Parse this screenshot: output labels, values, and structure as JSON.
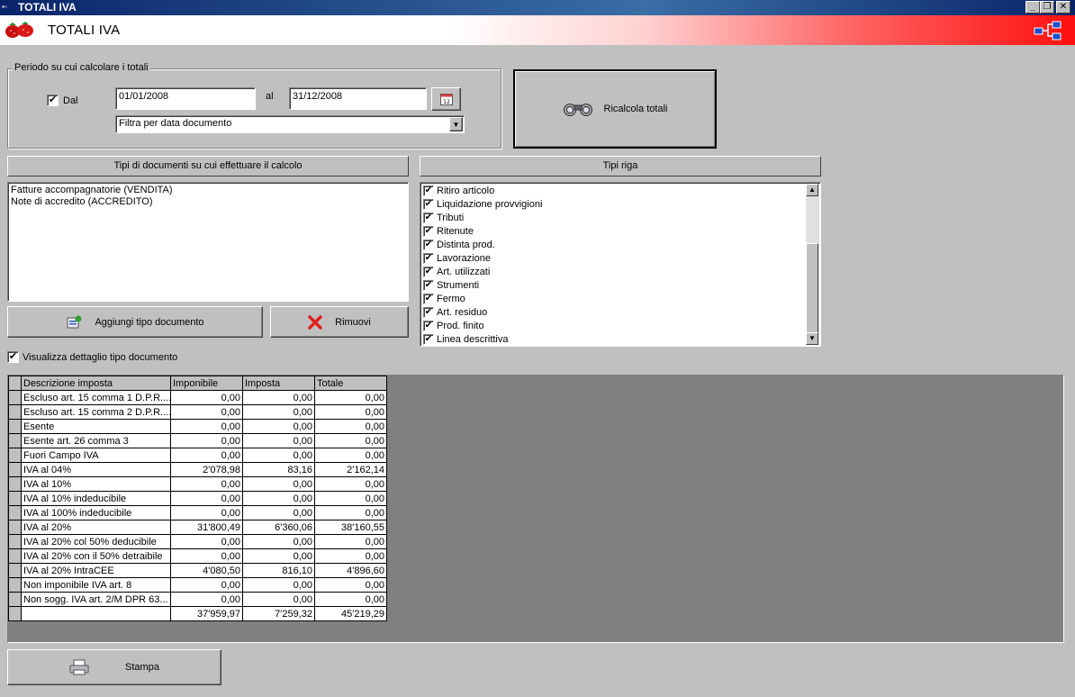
{
  "window": {
    "title": "TOTALI IVA",
    "min": "_",
    "restore": "❐",
    "close": "✕"
  },
  "header": {
    "title": "TOTALI IVA"
  },
  "period": {
    "legend": "Periodo su cui calcolare i totali",
    "dal_label": "Dal",
    "dal_checked": "✔",
    "date_from": "01/01/2008",
    "al_label": "al",
    "date_to": "31/12/2008",
    "calendar_label": "12",
    "filter_value": "Filtra per data documento"
  },
  "recalc": {
    "label": "Ricalcola totali"
  },
  "doc_types": {
    "header": "Tipi di documenti su cui effettuare il calcolo",
    "items": [
      "Fatture accompagnatorie (VENDITA)",
      "Note di accredito (ACCREDITO)"
    ],
    "add_label": "Aggiungi tipo documento",
    "remove_label": "Rimuovi"
  },
  "row_types": {
    "header": "Tipi riga",
    "check": "✔",
    "items": [
      "Ritiro articolo",
      "Liquidazione provvigioni",
      "Tributi",
      "Ritenute",
      "Distinta prod.",
      "Lavorazione",
      "Art. utilizzati",
      "Strumenti",
      "Fermo",
      "Art. residuo",
      "Prod. finito",
      "Linea descrittiva"
    ]
  },
  "detail": {
    "label": "Visualizza dettaglio tipo documento",
    "checked": "✔"
  },
  "grid": {
    "columns": [
      "Descrizione imposta",
      "Imponibile",
      "Imposta",
      "Totale"
    ],
    "rows": [
      [
        "Escluso art. 15 comma 1 D.P.R....",
        "0,00",
        "0,00",
        "0,00"
      ],
      [
        "Escluso art. 15 comma 2 D.P.R....",
        "0,00",
        "0,00",
        "0,00"
      ],
      [
        "Esente",
        "0,00",
        "0,00",
        "0,00"
      ],
      [
        "Esente art. 26 comma 3",
        "0,00",
        "0,00",
        "0,00"
      ],
      [
        "Fuori Campo IVA",
        "0,00",
        "0,00",
        "0,00"
      ],
      [
        "IVA al 04%",
        "2'078,98",
        "83,16",
        "2'162,14"
      ],
      [
        "IVA al 10%",
        "0,00",
        "0,00",
        "0,00"
      ],
      [
        "IVA al 10% indeducibile",
        "0,00",
        "0,00",
        "0,00"
      ],
      [
        "IVA al 100% indeducibile",
        "0,00",
        "0,00",
        "0,00"
      ],
      [
        "IVA al 20%",
        "31'800,49",
        "6'360,06",
        "38'160,55"
      ],
      [
        "IVA al 20% col 50% deducibile",
        "0,00",
        "0,00",
        "0,00"
      ],
      [
        "IVA al 20% con il 50% detraibile",
        "0,00",
        "0,00",
        "0,00"
      ],
      [
        "IVA al 20% IntraCEE",
        "4'080,50",
        "816,10",
        "4'896,60"
      ],
      [
        "Non imponibile IVA art. 8",
        "0,00",
        "0,00",
        "0,00"
      ],
      [
        "Non sogg. IVA art. 2/M DPR 63...",
        "0,00",
        "0,00",
        "0,00"
      ]
    ],
    "totals": [
      "",
      "37'959,97",
      "7'259,32",
      "45'219,29"
    ]
  },
  "print": {
    "label": "Stampa"
  },
  "icons": {
    "app": "app-icon",
    "logo": "strawberry-icon",
    "network": "network-icon",
    "calendar": "calendar-icon",
    "binoculars": "binoculars-icon",
    "add": "add-document-icon",
    "remove": "red-x-icon",
    "printer": "printer-icon"
  }
}
